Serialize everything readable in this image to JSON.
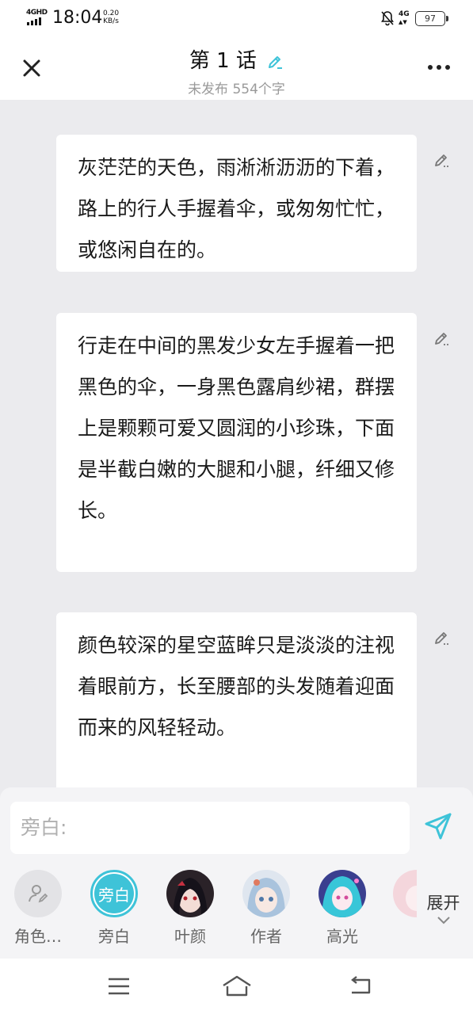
{
  "status_bar": {
    "network_type": "4GHD",
    "time": "18:04",
    "net_speed_value": "0.20",
    "net_speed_unit": "KB/s",
    "secondary_network": "4G",
    "battery_level": "97"
  },
  "header": {
    "title": "第 1 话",
    "subtitle": "未发布 554个字"
  },
  "paragraphs": [
    {
      "text": "灰茫茫的天色，雨淅淅沥沥的下着，路上的行人手握着伞，或匆匆忙忙，或悠闲自在的。"
    },
    {
      "text": "行走在中间的黑发少女左手握着一把黑色的伞，一身黑色露肩纱裙，群摆上是颗颗可爱又圆润的小珍珠，下面是半截白嫩的大腿和小腿，纤细又修长。"
    },
    {
      "text": "颜色较深的星空蓝眸只是淡淡的注视着眼前方，长至腰部的头发随着迎面而来的风轻轻动。"
    }
  ],
  "composer": {
    "placeholder": "旁白:"
  },
  "characters": [
    {
      "name": "角色…",
      "avatar_icon": "character-manage-icon"
    },
    {
      "name": "旁白",
      "avatar_text": "旁白",
      "selected": true
    },
    {
      "name": "叶颜",
      "avatar_icon": "anime-girl-dark-hair-avatar"
    },
    {
      "name": "作者",
      "avatar_icon": "anime-girl-light-blue-hair-avatar"
    },
    {
      "name": "高光",
      "avatar_icon": "anime-girl-cyan-hair-avatar"
    }
  ],
  "expand_label": "展开",
  "colors": {
    "accent": "#3ec3d8",
    "background": "#ebebee",
    "card": "#ffffff"
  }
}
